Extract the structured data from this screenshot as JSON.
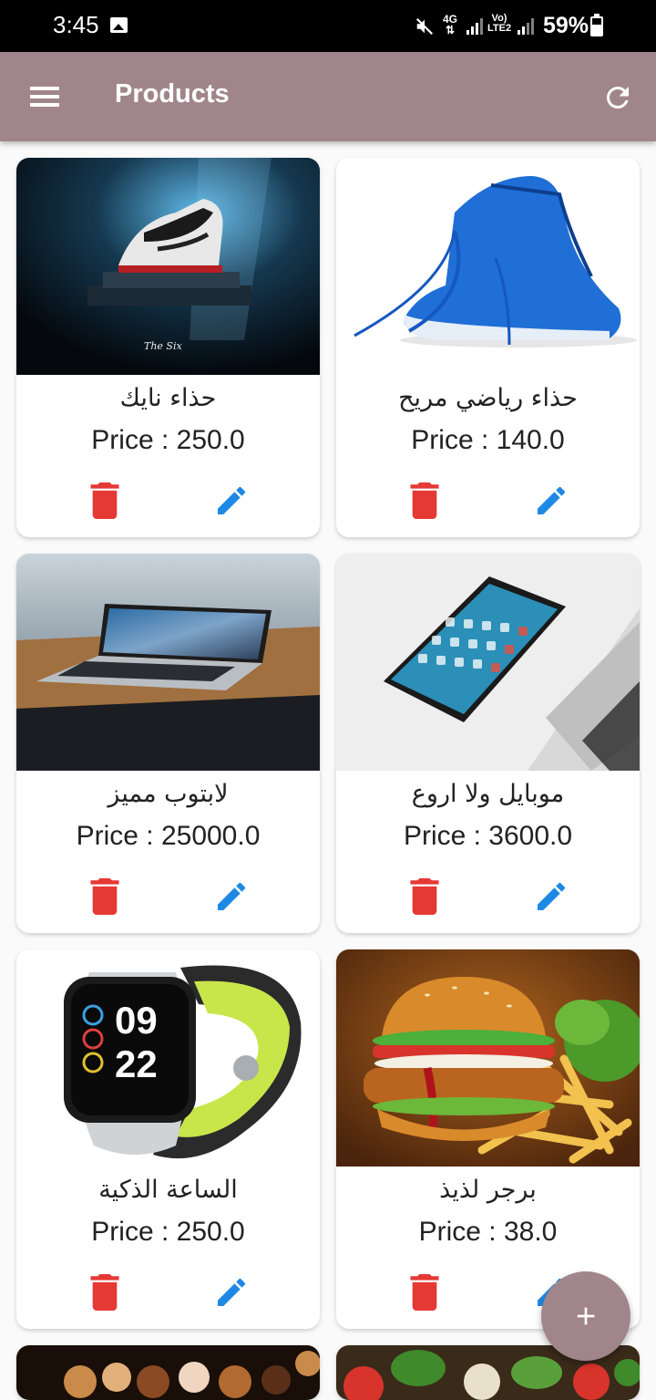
{
  "status_bar": {
    "time": "3:45",
    "network": "4G",
    "volte": "Vo) LTE2",
    "battery": "59%"
  },
  "app_bar": {
    "title": "Products",
    "menu_icon": "menu-icon",
    "refresh_icon": "refresh-icon"
  },
  "colors": {
    "app_bar": "#a0858b",
    "delete": "#e53935",
    "edit": "#1e88e5"
  },
  "products": [
    {
      "name": "حذاء نايك",
      "price": "Price : 250.0",
      "image": "nike-shoe-image"
    },
    {
      "name": "حذاء رياضي مريح",
      "price": "Price : 140.0",
      "image": "blue-running-shoe-image"
    },
    {
      "name": "لابتوب مميز",
      "price": "Price : 25000.0",
      "image": "laptop-image"
    },
    {
      "name": "موبايل ولا اروع",
      "price": "Price : 3600.0",
      "image": "smartphone-image"
    },
    {
      "name": "الساعة الذكية",
      "price": "Price : 250.0",
      "image": "smartwatch-image"
    },
    {
      "name": "برجر لذيذ",
      "price": "Price : 38.0",
      "image": "burger-image"
    }
  ],
  "fab": {
    "icon": "add-icon"
  }
}
